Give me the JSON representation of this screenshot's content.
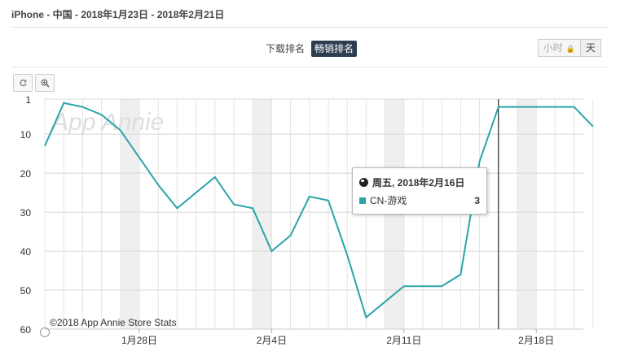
{
  "header": {
    "title": "iPhone - 中国 - 2018年1月23日 - 2018年2月21日"
  },
  "metric_tabs": [
    {
      "label": "下载排名",
      "active": false
    },
    {
      "label": "畅销排名",
      "active": true
    }
  ],
  "granularity": {
    "hour_label": "小时",
    "day_label": "天",
    "selected": "天"
  },
  "tools": {
    "reset_icon": "reset-icon",
    "zoom_icon": "zoom-icon"
  },
  "watermark": "App Annie",
  "credit": "©2018 App Annie Store Stats",
  "tooltip": {
    "date": "周五, 2018年2月16日",
    "series": "CN-游戏",
    "value": "3"
  },
  "colors": {
    "series": "#2aa5a8",
    "weekend_band": "#efefef",
    "active_tab": "#2d3e50"
  },
  "chart_data": {
    "type": "line",
    "title": "",
    "xlabel": "",
    "ylabel": "",
    "y_reversed": true,
    "ylim": [
      1,
      60
    ],
    "yticks": [
      1,
      10,
      20,
      30,
      40,
      50,
      60
    ],
    "x": [
      "2018-01-23",
      "2018-01-24",
      "2018-01-25",
      "2018-01-26",
      "2018-01-27",
      "2018-01-28",
      "2018-01-29",
      "2018-01-30",
      "2018-01-31",
      "2018-02-01",
      "2018-02-02",
      "2018-02-03",
      "2018-02-04",
      "2018-02-05",
      "2018-02-06",
      "2018-02-07",
      "2018-02-08",
      "2018-02-09",
      "2018-02-10",
      "2018-02-11",
      "2018-02-12",
      "2018-02-13",
      "2018-02-14",
      "2018-02-15",
      "2018-02-16",
      "2018-02-17",
      "2018-02-18",
      "2018-02-19",
      "2018-02-20",
      "2018-02-21"
    ],
    "xtick_labels": [
      {
        "date": "2018-01-28",
        "label": "1月28日"
      },
      {
        "date": "2018-02-04",
        "label": "2月4日"
      },
      {
        "date": "2018-02-11",
        "label": "2月11日"
      },
      {
        "date": "2018-02-18",
        "label": "2月18日"
      }
    ],
    "series": [
      {
        "name": "CN-游戏",
        "values": [
          13,
          2,
          3,
          5,
          9,
          16,
          23,
          29,
          25,
          21,
          28,
          29,
          40,
          36,
          26,
          27,
          41,
          57,
          53,
          49,
          49,
          49,
          46,
          17,
          3,
          3,
          3,
          3,
          3,
          8
        ]
      }
    ],
    "weekend_bands": [
      [
        "2018-01-27",
        "2018-01-28"
      ],
      [
        "2018-02-03",
        "2018-02-04"
      ],
      [
        "2018-02-10",
        "2018-02-11"
      ],
      [
        "2018-02-17",
        "2018-02-18"
      ]
    ],
    "highlight_date": "2018-02-16",
    "grid": true
  }
}
